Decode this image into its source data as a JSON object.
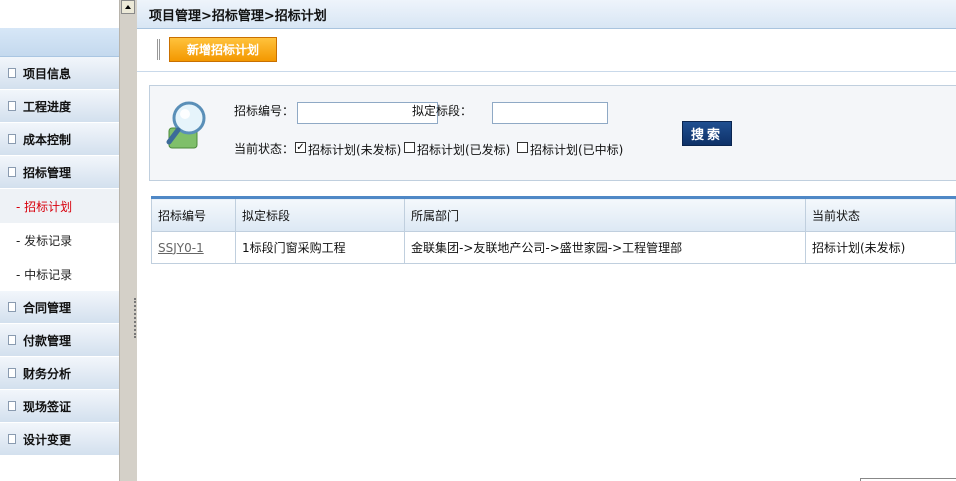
{
  "breadcrumb": "项目管理>招标管理>招标计划",
  "sidebar": {
    "items": [
      {
        "label": "项目信息",
        "type": "group"
      },
      {
        "label": "工程进度",
        "type": "group"
      },
      {
        "label": "成本控制",
        "type": "group"
      },
      {
        "label": "招标管理",
        "type": "group"
      },
      {
        "label": "- 招标计划",
        "type": "sub",
        "active": true
      },
      {
        "label": "- 发标记录",
        "type": "sub"
      },
      {
        "label": "- 中标记录",
        "type": "sub"
      },
      {
        "label": "合同管理",
        "type": "group"
      },
      {
        "label": "付款管理",
        "type": "group"
      },
      {
        "label": "财务分析",
        "type": "group"
      },
      {
        "label": "现场签证",
        "type": "group"
      },
      {
        "label": "设计变更",
        "type": "group"
      }
    ]
  },
  "toolbar": {
    "add_label": "新增招标计划"
  },
  "search": {
    "code_label": "招标编号：",
    "code_value": "",
    "section_label": "拟定标段：",
    "section_value": "",
    "status_label": "当前状态：",
    "options": [
      {
        "label": "招标计划(未发标)",
        "checked": true
      },
      {
        "label": "招标计划(已发标)",
        "checked": false
      },
      {
        "label": "招标计划(已中标)",
        "checked": false
      }
    ],
    "button_label": "搜索"
  },
  "table": {
    "headers": [
      "招标编号",
      "拟定标段",
      "所属部门",
      "当前状态"
    ],
    "rows": [
      [
        "SSJY0-1",
        "1标段门窗采购工程",
        "金联集团->友联地产公司->盛世家园->工程管理部",
        "招标计划(未发标)"
      ]
    ]
  },
  "colors": {
    "accent": "#f39800",
    "header_line": "#4f88c6",
    "search_button": "#1f4f91",
    "active_item": "#d8000c"
  }
}
